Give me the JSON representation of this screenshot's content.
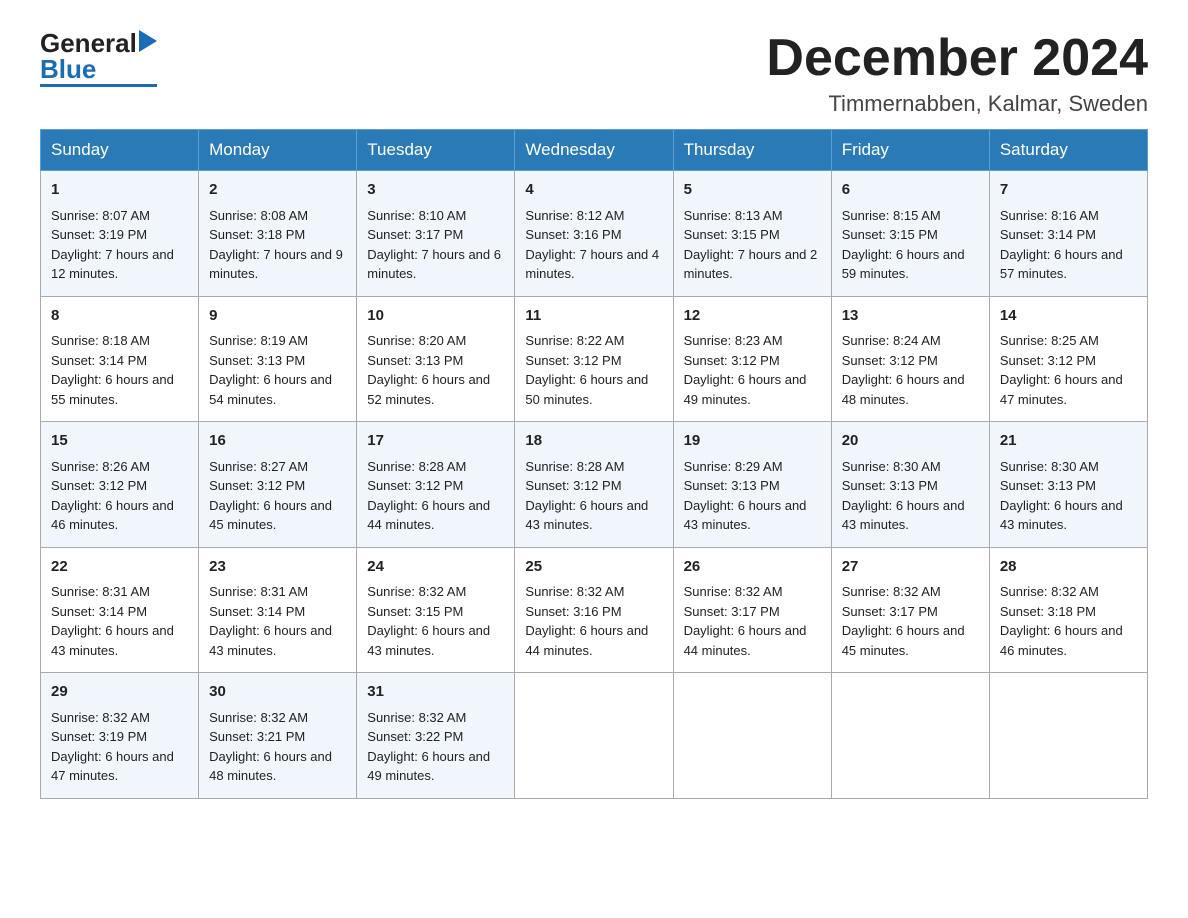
{
  "header": {
    "title": "December 2024",
    "subtitle": "Timmernabben, Kalmar, Sweden",
    "logo_general": "General",
    "logo_blue": "Blue"
  },
  "days_of_week": [
    "Sunday",
    "Monday",
    "Tuesday",
    "Wednesday",
    "Thursday",
    "Friday",
    "Saturday"
  ],
  "weeks": [
    [
      {
        "day": "1",
        "sunrise": "Sunrise: 8:07 AM",
        "sunset": "Sunset: 3:19 PM",
        "daylight": "Daylight: 7 hours and 12 minutes."
      },
      {
        "day": "2",
        "sunrise": "Sunrise: 8:08 AM",
        "sunset": "Sunset: 3:18 PM",
        "daylight": "Daylight: 7 hours and 9 minutes."
      },
      {
        "day": "3",
        "sunrise": "Sunrise: 8:10 AM",
        "sunset": "Sunset: 3:17 PM",
        "daylight": "Daylight: 7 hours and 6 minutes."
      },
      {
        "day": "4",
        "sunrise": "Sunrise: 8:12 AM",
        "sunset": "Sunset: 3:16 PM",
        "daylight": "Daylight: 7 hours and 4 minutes."
      },
      {
        "day": "5",
        "sunrise": "Sunrise: 8:13 AM",
        "sunset": "Sunset: 3:15 PM",
        "daylight": "Daylight: 7 hours and 2 minutes."
      },
      {
        "day": "6",
        "sunrise": "Sunrise: 8:15 AM",
        "sunset": "Sunset: 3:15 PM",
        "daylight": "Daylight: 6 hours and 59 minutes."
      },
      {
        "day": "7",
        "sunrise": "Sunrise: 8:16 AM",
        "sunset": "Sunset: 3:14 PM",
        "daylight": "Daylight: 6 hours and 57 minutes."
      }
    ],
    [
      {
        "day": "8",
        "sunrise": "Sunrise: 8:18 AM",
        "sunset": "Sunset: 3:14 PM",
        "daylight": "Daylight: 6 hours and 55 minutes."
      },
      {
        "day": "9",
        "sunrise": "Sunrise: 8:19 AM",
        "sunset": "Sunset: 3:13 PM",
        "daylight": "Daylight: 6 hours and 54 minutes."
      },
      {
        "day": "10",
        "sunrise": "Sunrise: 8:20 AM",
        "sunset": "Sunset: 3:13 PM",
        "daylight": "Daylight: 6 hours and 52 minutes."
      },
      {
        "day": "11",
        "sunrise": "Sunrise: 8:22 AM",
        "sunset": "Sunset: 3:12 PM",
        "daylight": "Daylight: 6 hours and 50 minutes."
      },
      {
        "day": "12",
        "sunrise": "Sunrise: 8:23 AM",
        "sunset": "Sunset: 3:12 PM",
        "daylight": "Daylight: 6 hours and 49 minutes."
      },
      {
        "day": "13",
        "sunrise": "Sunrise: 8:24 AM",
        "sunset": "Sunset: 3:12 PM",
        "daylight": "Daylight: 6 hours and 48 minutes."
      },
      {
        "day": "14",
        "sunrise": "Sunrise: 8:25 AM",
        "sunset": "Sunset: 3:12 PM",
        "daylight": "Daylight: 6 hours and 47 minutes."
      }
    ],
    [
      {
        "day": "15",
        "sunrise": "Sunrise: 8:26 AM",
        "sunset": "Sunset: 3:12 PM",
        "daylight": "Daylight: 6 hours and 46 minutes."
      },
      {
        "day": "16",
        "sunrise": "Sunrise: 8:27 AM",
        "sunset": "Sunset: 3:12 PM",
        "daylight": "Daylight: 6 hours and 45 minutes."
      },
      {
        "day": "17",
        "sunrise": "Sunrise: 8:28 AM",
        "sunset": "Sunset: 3:12 PM",
        "daylight": "Daylight: 6 hours and 44 minutes."
      },
      {
        "day": "18",
        "sunrise": "Sunrise: 8:28 AM",
        "sunset": "Sunset: 3:12 PM",
        "daylight": "Daylight: 6 hours and 43 minutes."
      },
      {
        "day": "19",
        "sunrise": "Sunrise: 8:29 AM",
        "sunset": "Sunset: 3:13 PM",
        "daylight": "Daylight: 6 hours and 43 minutes."
      },
      {
        "day": "20",
        "sunrise": "Sunrise: 8:30 AM",
        "sunset": "Sunset: 3:13 PM",
        "daylight": "Daylight: 6 hours and 43 minutes."
      },
      {
        "day": "21",
        "sunrise": "Sunrise: 8:30 AM",
        "sunset": "Sunset: 3:13 PM",
        "daylight": "Daylight: 6 hours and 43 minutes."
      }
    ],
    [
      {
        "day": "22",
        "sunrise": "Sunrise: 8:31 AM",
        "sunset": "Sunset: 3:14 PM",
        "daylight": "Daylight: 6 hours and 43 minutes."
      },
      {
        "day": "23",
        "sunrise": "Sunrise: 8:31 AM",
        "sunset": "Sunset: 3:14 PM",
        "daylight": "Daylight: 6 hours and 43 minutes."
      },
      {
        "day": "24",
        "sunrise": "Sunrise: 8:32 AM",
        "sunset": "Sunset: 3:15 PM",
        "daylight": "Daylight: 6 hours and 43 minutes."
      },
      {
        "day": "25",
        "sunrise": "Sunrise: 8:32 AM",
        "sunset": "Sunset: 3:16 PM",
        "daylight": "Daylight: 6 hours and 44 minutes."
      },
      {
        "day": "26",
        "sunrise": "Sunrise: 8:32 AM",
        "sunset": "Sunset: 3:17 PM",
        "daylight": "Daylight: 6 hours and 44 minutes."
      },
      {
        "day": "27",
        "sunrise": "Sunrise: 8:32 AM",
        "sunset": "Sunset: 3:17 PM",
        "daylight": "Daylight: 6 hours and 45 minutes."
      },
      {
        "day": "28",
        "sunrise": "Sunrise: 8:32 AM",
        "sunset": "Sunset: 3:18 PM",
        "daylight": "Daylight: 6 hours and 46 minutes."
      }
    ],
    [
      {
        "day": "29",
        "sunrise": "Sunrise: 8:32 AM",
        "sunset": "Sunset: 3:19 PM",
        "daylight": "Daylight: 6 hours and 47 minutes."
      },
      {
        "day": "30",
        "sunrise": "Sunrise: 8:32 AM",
        "sunset": "Sunset: 3:21 PM",
        "daylight": "Daylight: 6 hours and 48 minutes."
      },
      {
        "day": "31",
        "sunrise": "Sunrise: 8:32 AM",
        "sunset": "Sunset: 3:22 PM",
        "daylight": "Daylight: 6 hours and 49 minutes."
      },
      null,
      null,
      null,
      null
    ]
  ]
}
